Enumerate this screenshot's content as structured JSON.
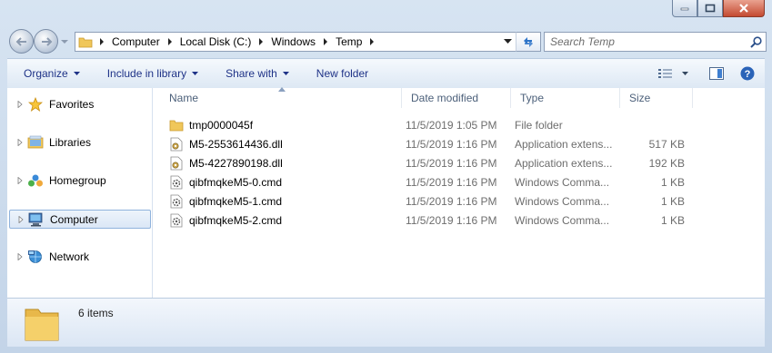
{
  "window": {
    "caption_buttons": [
      "minimize",
      "maximize",
      "close"
    ]
  },
  "address": {
    "crumbs": [
      "Computer",
      "Local Disk (C:)",
      "Windows",
      "Temp"
    ]
  },
  "search": {
    "placeholder": "Search Temp"
  },
  "toolbar": {
    "organize": "Organize",
    "include_in_library": "Include in library",
    "share_with": "Share with",
    "new_folder": "New folder"
  },
  "nav": {
    "items": [
      {
        "label": "Favorites",
        "icon": "star-icon"
      },
      {
        "label": "Libraries",
        "icon": "libraries-icon"
      },
      {
        "label": "Homegroup",
        "icon": "homegroup-icon"
      },
      {
        "label": "Computer",
        "icon": "computer-icon",
        "selected": true
      },
      {
        "label": "Network",
        "icon": "network-icon"
      }
    ]
  },
  "columns": {
    "name": "Name",
    "date_modified": "Date modified",
    "type": "Type",
    "size": "Size"
  },
  "files": [
    {
      "name": "tmp0000045f",
      "date": "11/5/2019 1:05 PM",
      "type": "File folder",
      "size": "",
      "icon": "folder-icon"
    },
    {
      "name": "M5-2553614436.dll",
      "date": "11/5/2019 1:16 PM",
      "type": "Application extens...",
      "size": "517 KB",
      "icon": "dll-file-icon"
    },
    {
      "name": "M5-4227890198.dll",
      "date": "11/5/2019 1:16 PM",
      "type": "Application extens...",
      "size": "192 KB",
      "icon": "dll-file-icon"
    },
    {
      "name": "qibfmqkeM5-0.cmd",
      "date": "11/5/2019 1:16 PM",
      "type": "Windows Comma...",
      "size": "1 KB",
      "icon": "cmd-file-icon"
    },
    {
      "name": "qibfmqkeM5-1.cmd",
      "date": "11/5/2019 1:16 PM",
      "type": "Windows Comma...",
      "size": "1 KB",
      "icon": "cmd-file-icon"
    },
    {
      "name": "qibfmqkeM5-2.cmd",
      "date": "11/5/2019 1:16 PM",
      "type": "Windows Comma...",
      "size": "1 KB",
      "icon": "cmd-file-icon"
    }
  ],
  "status": {
    "item_count": "6 items"
  }
}
